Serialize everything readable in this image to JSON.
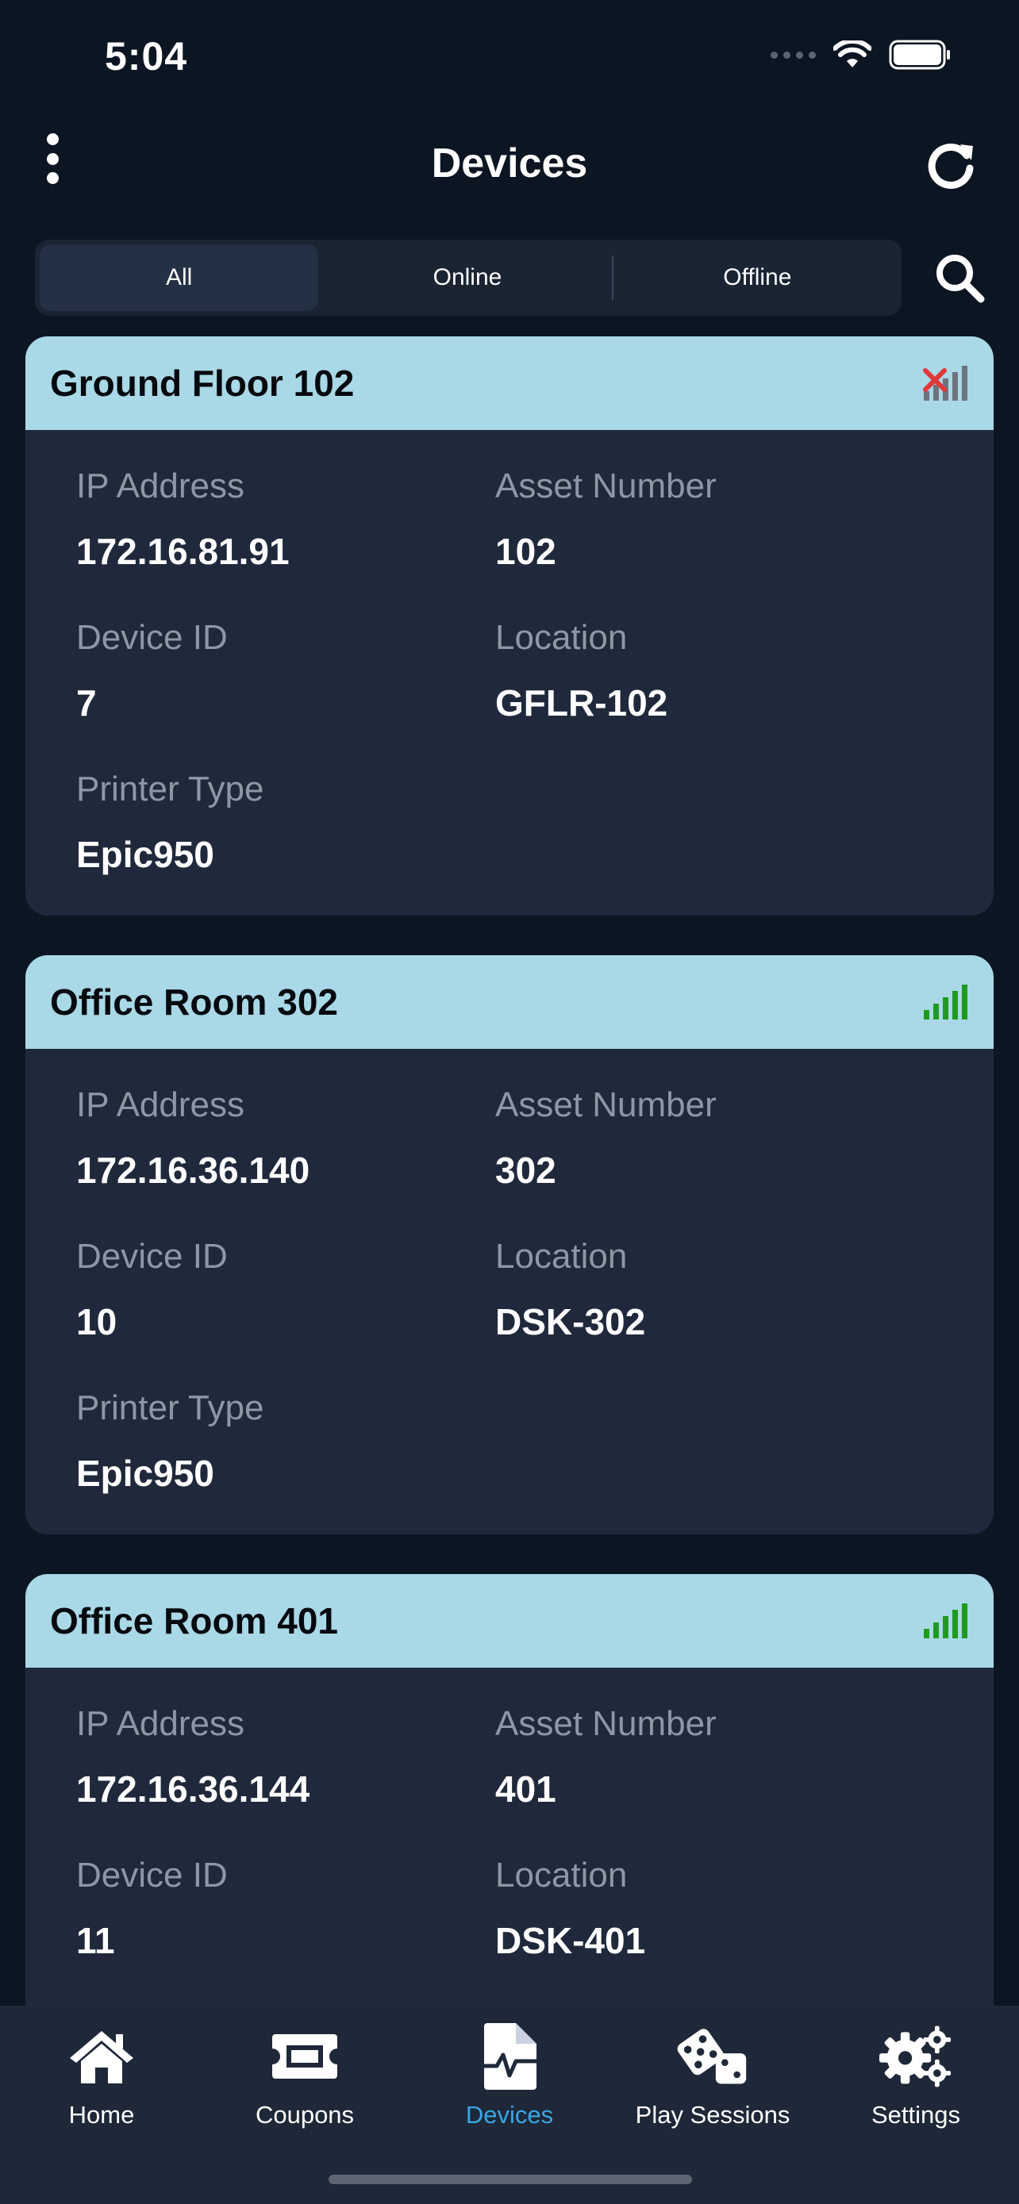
{
  "status_bar": {
    "time": "5:04"
  },
  "header": {
    "title": "Devices"
  },
  "filter": {
    "tabs": [
      "All",
      "Online",
      "Offline"
    ],
    "selected": "All"
  },
  "labels": {
    "ip": "IP Address",
    "asset": "Asset Number",
    "device_id": "Device ID",
    "location": "Location",
    "printer_type": "Printer Type"
  },
  "devices": [
    {
      "name": "Ground Floor 102",
      "status": "offline",
      "ip": "172.16.81.91",
      "asset": "102",
      "device_id": "7",
      "location": "GFLR-102",
      "printer_type": "Epic950"
    },
    {
      "name": "Office Room 302",
      "status": "online",
      "ip": "172.16.36.140",
      "asset": "302",
      "device_id": "10",
      "location": "DSK-302",
      "printer_type": "Epic950"
    },
    {
      "name": "Office Room 401",
      "status": "online",
      "ip": "172.16.36.144",
      "asset": "401",
      "device_id": "11",
      "location": "DSK-401"
    }
  ],
  "tabbar": {
    "items": [
      {
        "label": "Home",
        "icon": "home-icon"
      },
      {
        "label": "Coupons",
        "icon": "coupon-icon"
      },
      {
        "label": "Devices",
        "icon": "device-file-icon"
      },
      {
        "label": "Play Sessions",
        "icon": "dice-icon"
      },
      {
        "label": "Settings",
        "icon": "gears-icon"
      }
    ],
    "selected": "Devices"
  },
  "colors": {
    "background": "#0c1522",
    "card": "#1f293b",
    "card_header": "#a9d8e6",
    "online": "#1f9a1f",
    "offline": "#e0383b",
    "accent": "#3aa6e6"
  }
}
